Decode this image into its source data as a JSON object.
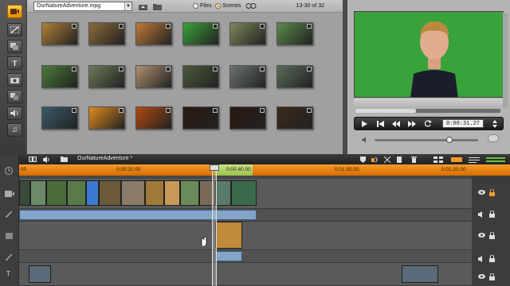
{
  "library": {
    "file_name": "OurNatureAdventure.mpg",
    "view_files_label": "Files",
    "view_scenes_label": "Scenes",
    "scene_count": "13-30 of 32",
    "thumbnails": [
      {
        "name": "scene-thumb",
        "color": "#b08038"
      },
      {
        "name": "scene-thumb",
        "color": "#8a6a3a"
      },
      {
        "name": "scene-thumb",
        "color": "#c07a38"
      },
      {
        "name": "scene-thumb",
        "color": "#3aa23a"
      },
      {
        "name": "scene-thumb",
        "color": "#7c8a5a"
      },
      {
        "name": "scene-thumb",
        "color": "#5c8a4a"
      },
      {
        "name": "scene-thumb",
        "color": "#4c7a3a"
      },
      {
        "name": "scene-thumb",
        "color": "#6a7a5a"
      },
      {
        "name": "scene-thumb",
        "color": "#b09070"
      },
      {
        "name": "scene-thumb",
        "color": "#4a5a3a"
      },
      {
        "name": "scene-thumb",
        "color": "#6a7470"
      },
      {
        "name": "scene-thumb",
        "color": "#5a6a5a"
      },
      {
        "name": "scene-thumb",
        "color": "#3a5a6a"
      },
      {
        "name": "scene-thumb",
        "color": "#e08a20"
      },
      {
        "name": "scene-thumb",
        "color": "#b04a10"
      },
      {
        "name": "scene-thumb",
        "color": "#2a1a10"
      },
      {
        "name": "scene-thumb",
        "color": "#2a1810"
      },
      {
        "name": "scene-thumb",
        "color": "#3a2a1a"
      }
    ]
  },
  "preview": {
    "timecode": "0:00:31.27",
    "progress": 0.42,
    "volume": 0.72
  },
  "timeline": {
    "project_title": "OurNatureAdventure *",
    "ruler_labels": [
      "00",
      "0:00:20.00",
      "0:00:40.00",
      "0:01:00.00",
      "0:01:20.00"
    ]
  },
  "colors": {
    "accent": "#f39a2c",
    "greenscreen": "#3aa23a"
  }
}
